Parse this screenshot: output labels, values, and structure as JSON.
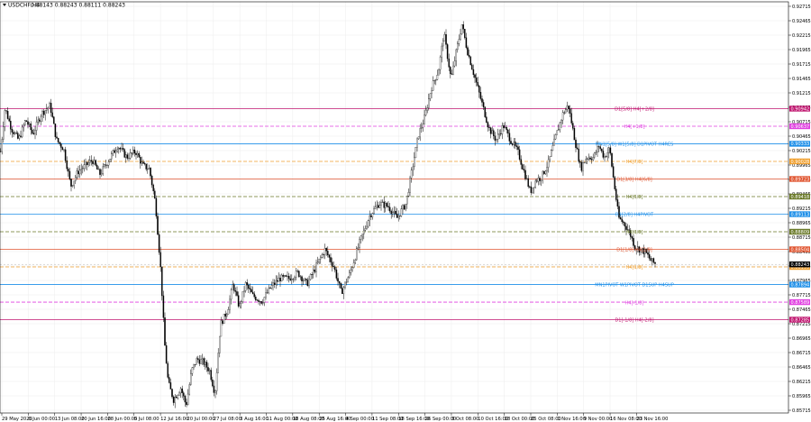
{
  "header": {
    "symbol": "USDCHF,H4",
    "ohlc": "0.88143 0.88243 0.88111 0.88243"
  },
  "colors": {
    "background": "#ffffff",
    "grid": "#ececec",
    "candles": "#000000",
    "axis": "#000000"
  },
  "chart_data": {
    "type": "candlestick",
    "symbol": "USDCHF",
    "timeframe": "H4",
    "ylim": [
      0.8564,
      0.928
    ],
    "y_ticks": [
      "0.92715",
      "0.92465",
      "0.92215",
      "0.91965",
      "0.91715",
      "0.91465",
      "0.91215",
      "0.90965",
      "0.90715",
      "0.90465",
      "0.90215",
      "0.89965",
      "0.89715",
      "0.89465",
      "0.89215",
      "0.88965",
      "0.88715",
      "0.88465",
      "0.88215",
      "0.87965",
      "0.87715",
      "0.87465",
      "0.87215",
      "0.86965",
      "0.86715",
      "0.86465",
      "0.86215",
      "0.85965",
      "0.85715",
      "0.85465"
    ],
    "y_tick_values": [
      0.92715,
      0.92465,
      0.92215,
      0.91965,
      0.91715,
      0.91465,
      0.91215,
      0.90965,
      0.90715,
      0.90465,
      0.90215,
      0.89965,
      0.89715,
      0.89465,
      0.89215,
      0.88965,
      0.88715,
      0.88465,
      0.88215,
      0.87965,
      0.87715,
      0.87465,
      0.87215,
      0.86965,
      0.86715,
      0.86465,
      0.86215,
      0.85965,
      0.85715,
      0.85465
    ],
    "x_ticks": [
      "29 May 2023",
      "6 Jun 00:00",
      "13 Jun 08:00",
      "20 Jun 16:00",
      "28 Jun 00:00",
      "5 Jul 08:00",
      "12 Jul 16:00",
      "20 Jul 00:00",
      "27 Jul 08:00",
      "3 Aug 16:00",
      "11 Aug 00:00",
      "18 Aug 08:00",
      "25 Aug 16:00",
      "4 Sep 00:00",
      "11 Sep 08:00",
      "18 Sep 16:00",
      "26 Sep 00:00",
      "3 Oct 08:00",
      "10 Oct 16:00",
      "18 Oct 00:00",
      "25 Oct 08:00",
      "1 Nov 16:00",
      "9 Nov 00:00",
      "16 Nov 08:00",
      "23 Nov 16:00"
    ],
    "close_path": [
      [
        0,
        0.902
      ],
      [
        5,
        0.9095
      ],
      [
        12,
        0.906
      ],
      [
        20,
        0.904
      ],
      [
        28,
        0.9075
      ],
      [
        36,
        0.905
      ],
      [
        45,
        0.9085
      ],
      [
        55,
        0.91
      ],
      [
        62,
        0.904
      ],
      [
        70,
        0.9025
      ],
      [
        78,
        0.896
      ],
      [
        86,
        0.8985
      ],
      [
        94,
        0.8995
      ],
      [
        102,
        0.9005
      ],
      [
        110,
        0.898
      ],
      [
        120,
        0.9005
      ],
      [
        130,
        0.903
      ],
      [
        140,
        0.901
      ],
      [
        150,
        0.902
      ],
      [
        158,
        0.8995
      ],
      [
        165,
        0.899
      ],
      [
        172,
        0.893
      ],
      [
        178,
        0.881
      ],
      [
        182,
        0.869
      ],
      [
        186,
        0.862
      ],
      [
        192,
        0.859
      ],
      [
        200,
        0.861
      ],
      [
        206,
        0.858
      ],
      [
        212,
        0.864
      ],
      [
        218,
        0.866
      ],
      [
        225,
        0.8655
      ],
      [
        232,
        0.864
      ],
      [
        238,
        0.86
      ],
      [
        244,
        0.872
      ],
      [
        252,
        0.8745
      ],
      [
        258,
        0.879
      ],
      [
        265,
        0.875
      ],
      [
        272,
        0.879
      ],
      [
        280,
        0.877
      ],
      [
        290,
        0.876
      ],
      [
        300,
        0.8785
      ],
      [
        310,
        0.88
      ],
      [
        320,
        0.88
      ],
      [
        330,
        0.881
      ],
      [
        340,
        0.879
      ],
      [
        350,
        0.882
      ],
      [
        360,
        0.885
      ],
      [
        370,
        0.882
      ],
      [
        378,
        0.8775
      ],
      [
        388,
        0.881
      ],
      [
        398,
        0.886
      ],
      [
        410,
        0.891
      ],
      [
        420,
        0.893
      ],
      [
        430,
        0.8925
      ],
      [
        440,
        0.8905
      ],
      [
        450,
        0.893
      ],
      [
        458,
        0.9
      ],
      [
        464,
        0.905
      ],
      [
        470,
        0.9075
      ],
      [
        478,
        0.913
      ],
      [
        486,
        0.916
      ],
      [
        492,
        0.9225
      ],
      [
        500,
        0.9145
      ],
      [
        506,
        0.9195
      ],
      [
        512,
        0.924
      ],
      [
        518,
        0.9195
      ],
      [
        526,
        0.915
      ],
      [
        534,
        0.9105
      ],
      [
        542,
        0.906
      ],
      [
        550,
        0.904
      ],
      [
        558,
        0.9065
      ],
      [
        566,
        0.904
      ],
      [
        574,
        0.902
      ],
      [
        580,
        0.899
      ],
      [
        588,
        0.895
      ],
      [
        594,
        0.897
      ],
      [
        600,
        0.8975
      ],
      [
        608,
        0.9
      ],
      [
        616,
        0.9045
      ],
      [
        624,
        0.9085
      ],
      [
        630,
        0.91
      ],
      [
        638,
        0.9035
      ],
      [
        644,
        0.899
      ],
      [
        650,
        0.901
      ],
      [
        658,
        0.901
      ],
      [
        664,
        0.903
      ],
      [
        670,
        0.901
      ],
      [
        676,
        0.9025
      ],
      [
        680,
        0.8975
      ],
      [
        686,
        0.8905
      ],
      [
        692,
        0.8895
      ],
      [
        698,
        0.888
      ],
      [
        704,
        0.8855
      ],
      [
        710,
        0.885
      ],
      [
        716,
        0.8845
      ],
      [
        722,
        0.883
      ],
      [
        728,
        0.8824
      ]
    ],
    "levels": [
      {
        "label": "D1[5/8] H4[+2/8]",
        "value": 0.90942,
        "color": "#c0156f",
        "style": "solid"
      },
      {
        "label": "H4[+1/8]",
        "value": 0.90637,
        "color": "#e040e0",
        "style": "dashed"
      },
      {
        "label": "MN1[5/8] W1[5/8] D1PIVOT H4RES",
        "value": 0.90333,
        "color": "#1e8fe8",
        "style": "solid"
      },
      {
        "label": "H4[7/8]",
        "value": 0.90028,
        "color": "#f0a030",
        "style": "dashed"
      },
      {
        "label": "D1[3/8] H4[6/8]",
        "value": 0.89723,
        "color": "#e05530",
        "style": "solid"
      },
      {
        "label": "H4[5/8]",
        "value": 0.89418,
        "color": "#6b7a2a",
        "style": "dashed"
      },
      {
        "label": "D1[2/8] H4PIVOT",
        "value": 0.89113,
        "color": "#1e8fe8",
        "style": "solid"
      },
      {
        "label": "H4[3/8]",
        "value": 0.88809,
        "color": "#6b7a2a",
        "style": "dashed"
      },
      {
        "label": "D1[1/8] H4[2/8]",
        "value": 0.88504,
        "color": "#e05530",
        "style": "solid"
      },
      {
        "label": "H4[1/8]",
        "value": 0.88199,
        "color": "#f0a030",
        "style": "dashed"
      },
      {
        "label": "MN1PIVOT W1PIVOT D1SUP H4SUP",
        "value": 0.87894,
        "color": "#1e8fe8",
        "style": "solid"
      },
      {
        "label": "H4[-1/8]",
        "value": 0.87589,
        "color": "#e040e0",
        "style": "dashed"
      },
      {
        "label": "D1[-1/8] H4[-2/8]",
        "value": 0.87285,
        "color": "#c0156f",
        "style": "solid"
      }
    ],
    "current_price": 0.88243
  }
}
